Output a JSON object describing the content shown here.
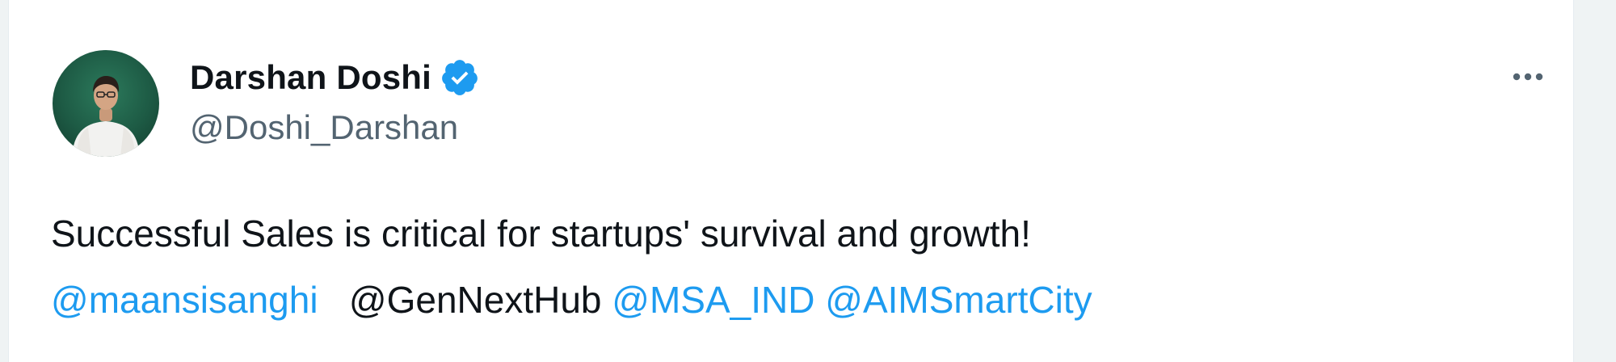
{
  "author": {
    "display_name": "Darshan Doshi",
    "handle": "@Doshi_Darshan",
    "verified": true,
    "verified_icon": "verified-badge-icon",
    "avatar_icon": "profile-avatar"
  },
  "menu": {
    "more_icon": "more-options-icon"
  },
  "tweet": {
    "text": "Successful Sales is critical for startups' survival and growth!",
    "mentions": [
      {
        "text": "@maansisanghi",
        "linked": true
      },
      {
        "text": "@GenNextHub",
        "linked": false
      },
      {
        "text": "@MSA_IND",
        "linked": true
      },
      {
        "text": "@AIMSmartCity",
        "linked": true
      }
    ]
  },
  "colors": {
    "link": "#1d9bf0",
    "text": "#0f1419",
    "secondary": "#536471",
    "verified": "#1d9bf0"
  }
}
